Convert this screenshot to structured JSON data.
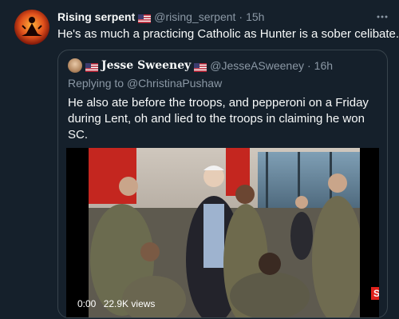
{
  "tweet": {
    "display_name": "Rising serpent",
    "handle": "@rising_serpent",
    "dot": "·",
    "time": "15h",
    "text": "He's as much a practicing Catholic as Hunter is a sober celibate.",
    "more_icon": "more-horizontal-icon",
    "avatar_icon": "meditating-figure-sunset-avatar"
  },
  "quote": {
    "display_name": "Jesse Sweeney",
    "handle": "@JesseASweeney",
    "dot": "·",
    "time": "16h",
    "reply_prefix": "Replying to",
    "reply_mention": "@ChristinaPushaw",
    "text": "He also ate before the troops, and pepperoni on a Friday during Lent, oh and lied to the troops in claiming he won SC."
  },
  "video": {
    "timestamp": "0:00",
    "views": "22.9K views",
    "brand_glyph": "S",
    "next_glyph": "‹"
  },
  "colors": {
    "background": "#15202b",
    "border": "#38444d",
    "secondary_text": "#8b98a5",
    "primary_text": "#f7f9f9"
  }
}
